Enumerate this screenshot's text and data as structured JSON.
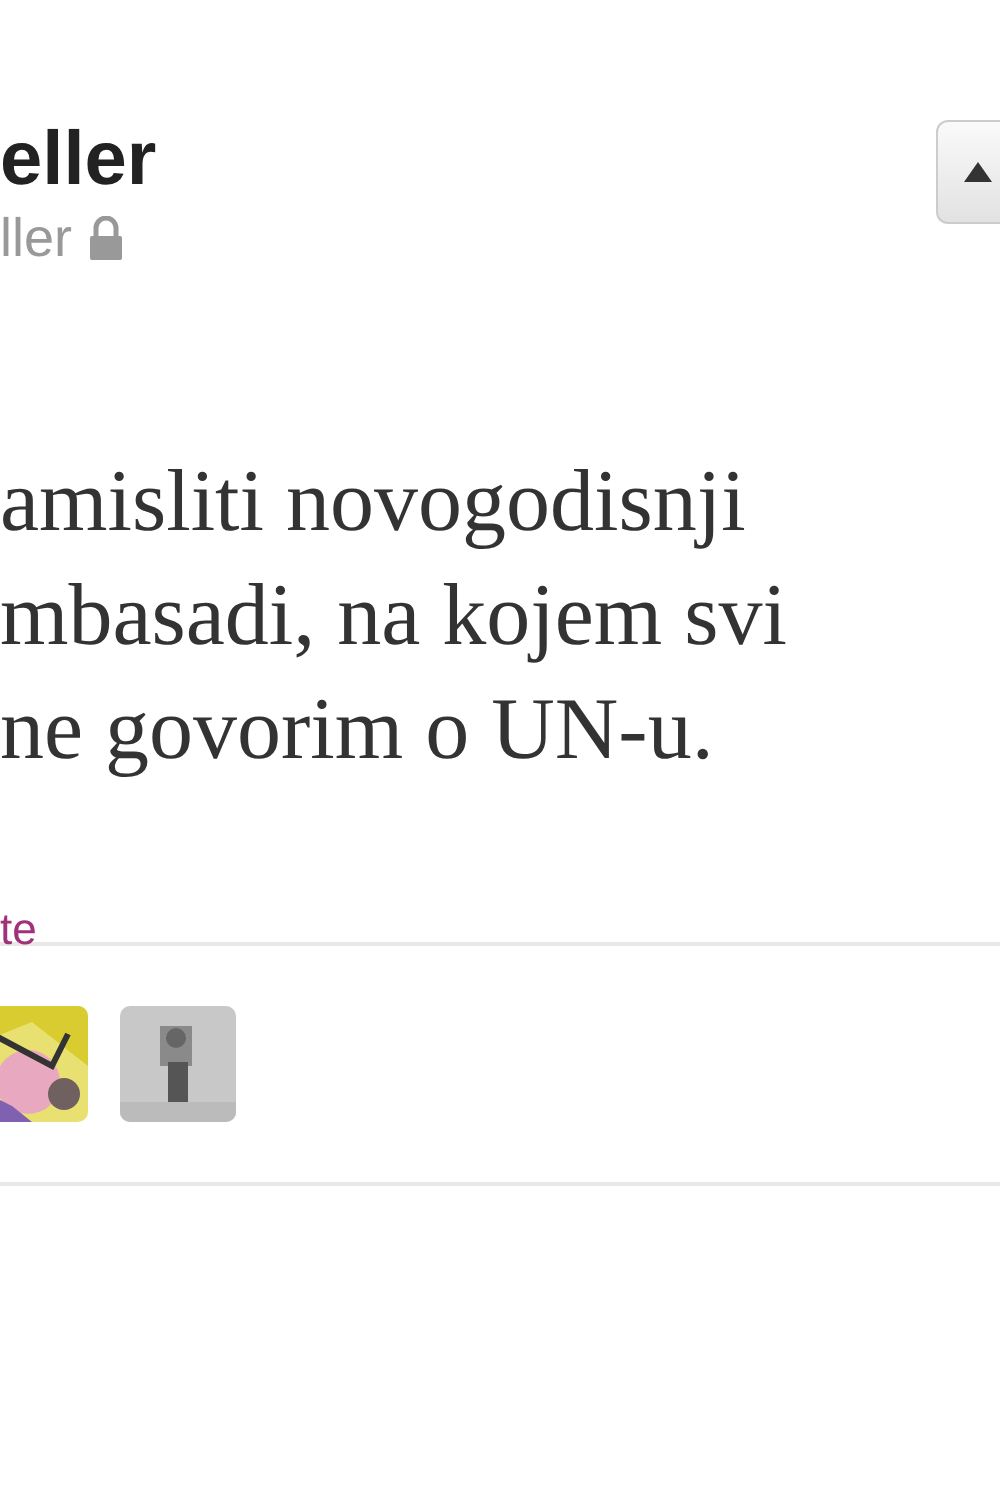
{
  "header": {
    "name": "eller",
    "handle": "ller",
    "protected": true
  },
  "tweet": {
    "lines": [
      "amisliti novogodisnji",
      "mbasadi, na kojem svi",
      "ne govorim o UN-u."
    ]
  },
  "action": {
    "label": "te"
  }
}
